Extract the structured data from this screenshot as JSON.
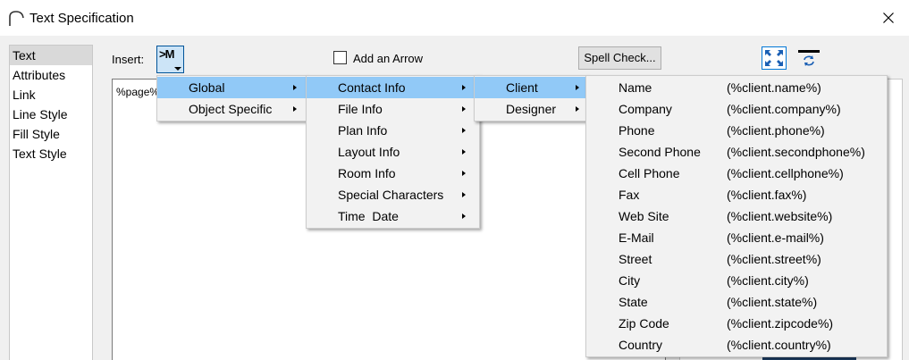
{
  "window": {
    "title": "Text Specification"
  },
  "sidebar": {
    "items": [
      {
        "label": "Text"
      },
      {
        "label": "Attributes"
      },
      {
        "label": "Link"
      },
      {
        "label": "Line Style"
      },
      {
        "label": "Fill Style"
      },
      {
        "label": "Text Style"
      }
    ],
    "selected": "Text"
  },
  "toolbar": {
    "insert_label": "Insert:",
    "insert_button": ">M",
    "add_arrow_label": "Add an Arrow",
    "add_arrow_checked": false,
    "spell_check_label": "Spell Check..."
  },
  "editor": {
    "content": "%page%"
  },
  "menus": {
    "level1": [
      {
        "label": "Global",
        "highlighted": true
      },
      {
        "label": "Object Specific",
        "highlighted": false
      }
    ],
    "level2": [
      {
        "label": "Contact Info",
        "highlighted": true
      },
      {
        "label": "File Info"
      },
      {
        "label": "Plan Info"
      },
      {
        "label": "Layout Info"
      },
      {
        "label": "Room Info"
      },
      {
        "label": "Special Characters"
      },
      {
        "label": "Time  Date"
      }
    ],
    "level3": [
      {
        "label": "Client",
        "highlighted": true
      },
      {
        "label": "Designer"
      }
    ],
    "level4": [
      {
        "label": "Name",
        "value": "(%client.name%)"
      },
      {
        "label": "Company",
        "value": "(%client.company%)"
      },
      {
        "label": "Phone",
        "value": "(%client.phone%)"
      },
      {
        "label": "Second Phone",
        "value": "(%client.secondphone%)"
      },
      {
        "label": "Cell Phone",
        "value": "(%client.cellphone%)"
      },
      {
        "label": "Fax",
        "value": "(%client.fax%)"
      },
      {
        "label": "Web Site",
        "value": "(%client.website%)"
      },
      {
        "label": "E-Mail",
        "value": "(%client.e-mail%)"
      },
      {
        "label": "Street",
        "value": "(%client.street%)"
      },
      {
        "label": "City",
        "value": "(%client.city%)"
      },
      {
        "label": "State",
        "value": "(%client.state%)"
      },
      {
        "label": "Zip Code",
        "value": "(%client.zipcode%)"
      },
      {
        "label": "Country",
        "value": "(%client.country%)"
      }
    ]
  },
  "colors": {
    "menu_highlight": "#91c9f7",
    "menu_background": "#f2f2f2",
    "insert_button_bg": "#cce4f7",
    "dialog_background": "#f0f0f0"
  }
}
